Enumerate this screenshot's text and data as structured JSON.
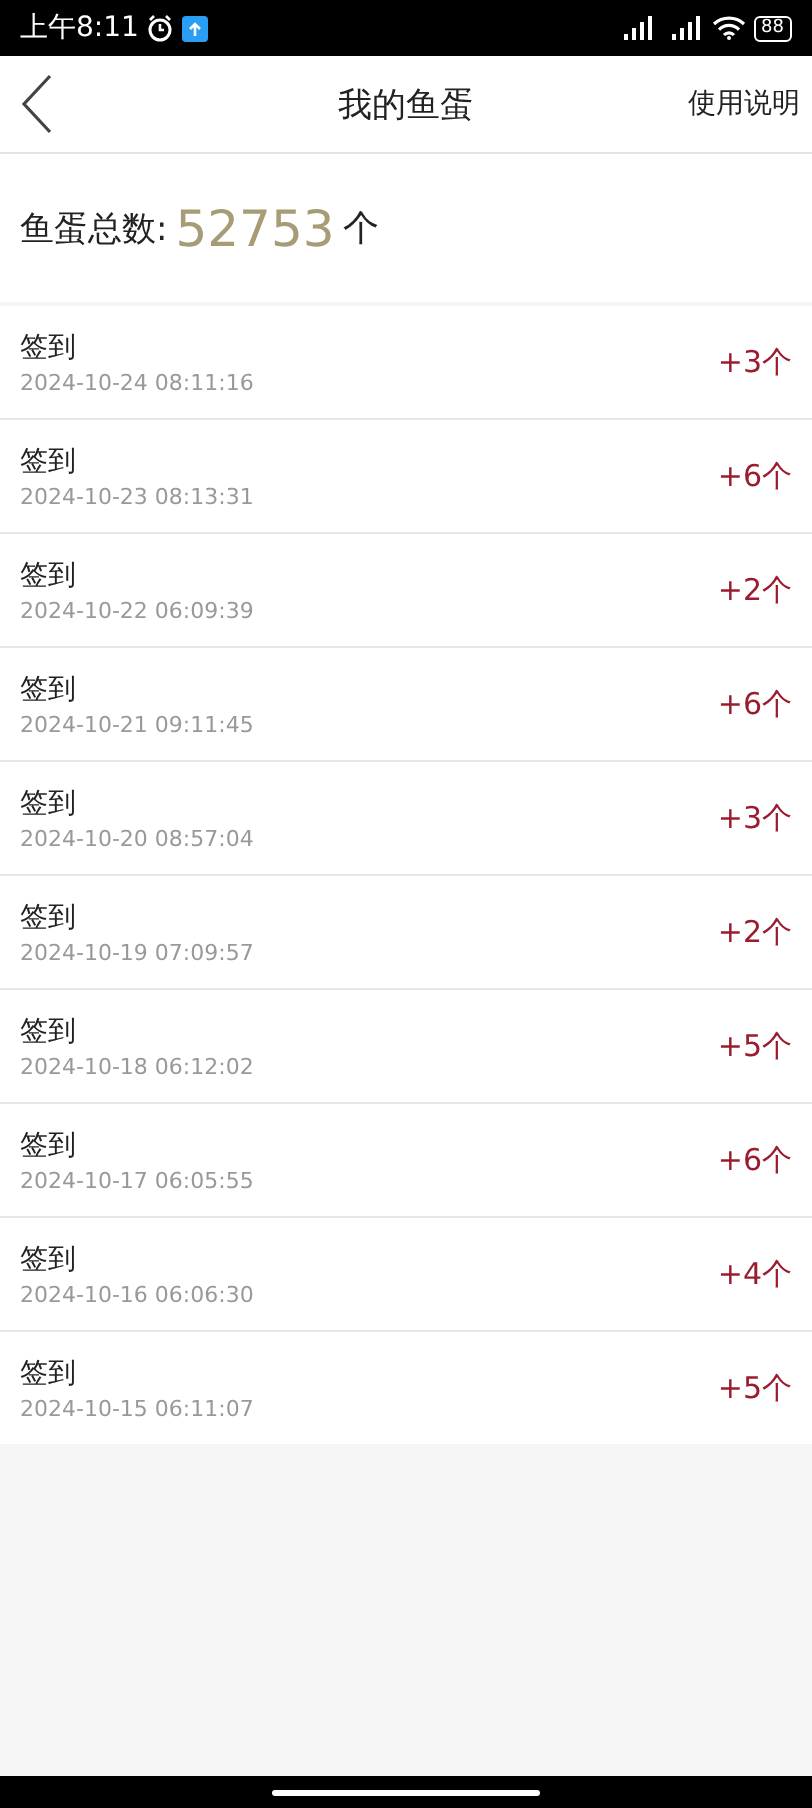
{
  "status_bar": {
    "time": "上午8:11",
    "battery": "88"
  },
  "header": {
    "title": "我的鱼蛋",
    "action": "使用说明"
  },
  "total": {
    "label": "鱼蛋总数:",
    "value": "52753",
    "unit": "个"
  },
  "records": [
    {
      "title": "签到",
      "time": "2024-10-24 08:11:16",
      "amount": "+3个"
    },
    {
      "title": "签到",
      "time": "2024-10-23 08:13:31",
      "amount": "+6个"
    },
    {
      "title": "签到",
      "time": "2024-10-22 06:09:39",
      "amount": "+2个"
    },
    {
      "title": "签到",
      "time": "2024-10-21 09:11:45",
      "amount": "+6个"
    },
    {
      "title": "签到",
      "time": "2024-10-20 08:57:04",
      "amount": "+3个"
    },
    {
      "title": "签到",
      "time": "2024-10-19 07:09:57",
      "amount": "+2个"
    },
    {
      "title": "签到",
      "time": "2024-10-18 06:12:02",
      "amount": "+5个"
    },
    {
      "title": "签到",
      "time": "2024-10-17 06:05:55",
      "amount": "+6个"
    },
    {
      "title": "签到",
      "time": "2024-10-16 06:06:30",
      "amount": "+4个"
    },
    {
      "title": "签到",
      "time": "2024-10-15 06:11:07",
      "amount": "+5个"
    }
  ]
}
